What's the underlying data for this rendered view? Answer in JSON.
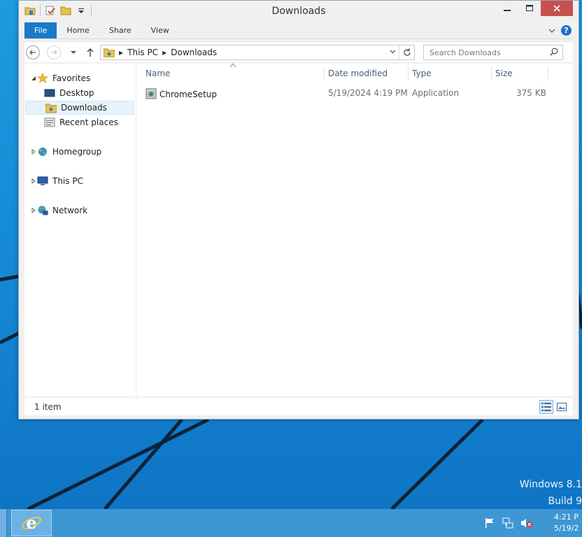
{
  "window": {
    "title": "Downloads"
  },
  "ribbon": {
    "tabs": [
      "File",
      "Home",
      "Share",
      "View"
    ],
    "help_glyph": "?"
  },
  "address": {
    "crumbs": [
      "This PC",
      "Downloads"
    ],
    "search_placeholder": "Search Downloads"
  },
  "nav_pane": {
    "favorites": {
      "label": "Favorites",
      "items": [
        "Desktop",
        "Downloads",
        "Recent places"
      ],
      "selected": "Downloads"
    },
    "groups": [
      "Homegroup",
      "This PC",
      "Network"
    ]
  },
  "file_list": {
    "columns": [
      "Name",
      "Date modified",
      "Type",
      "Size"
    ],
    "rows": [
      {
        "name": "ChromeSetup",
        "date_modified": "5/19/2024 4:19 PM",
        "type": "Application",
        "size": "375 KB"
      }
    ]
  },
  "status": {
    "item_count": "1 item"
  },
  "desktop": {
    "watermark_line1": "Windows 8.1",
    "watermark_line2": "Build 9"
  },
  "taskbar": {
    "clock_time": "4:21 P",
    "clock_date": "5/19/2"
  },
  "colors": {
    "file_tab": "#1979ca",
    "selection": "#e5f3fb",
    "desktop": "#1a8ad4",
    "taskbar": "#3e96d3",
    "close_button": "#c75050"
  },
  "icons": {
    "qat": [
      "folder-properties-icon",
      "new-folder-icon",
      "folder-icon",
      "customize-qat-icon"
    ],
    "nav": [
      "back-icon",
      "forward-icon",
      "recent-locations-icon",
      "up-icon"
    ],
    "tray": [
      "action-center-flag-icon",
      "network-icon",
      "volume-muted-icon"
    ]
  }
}
